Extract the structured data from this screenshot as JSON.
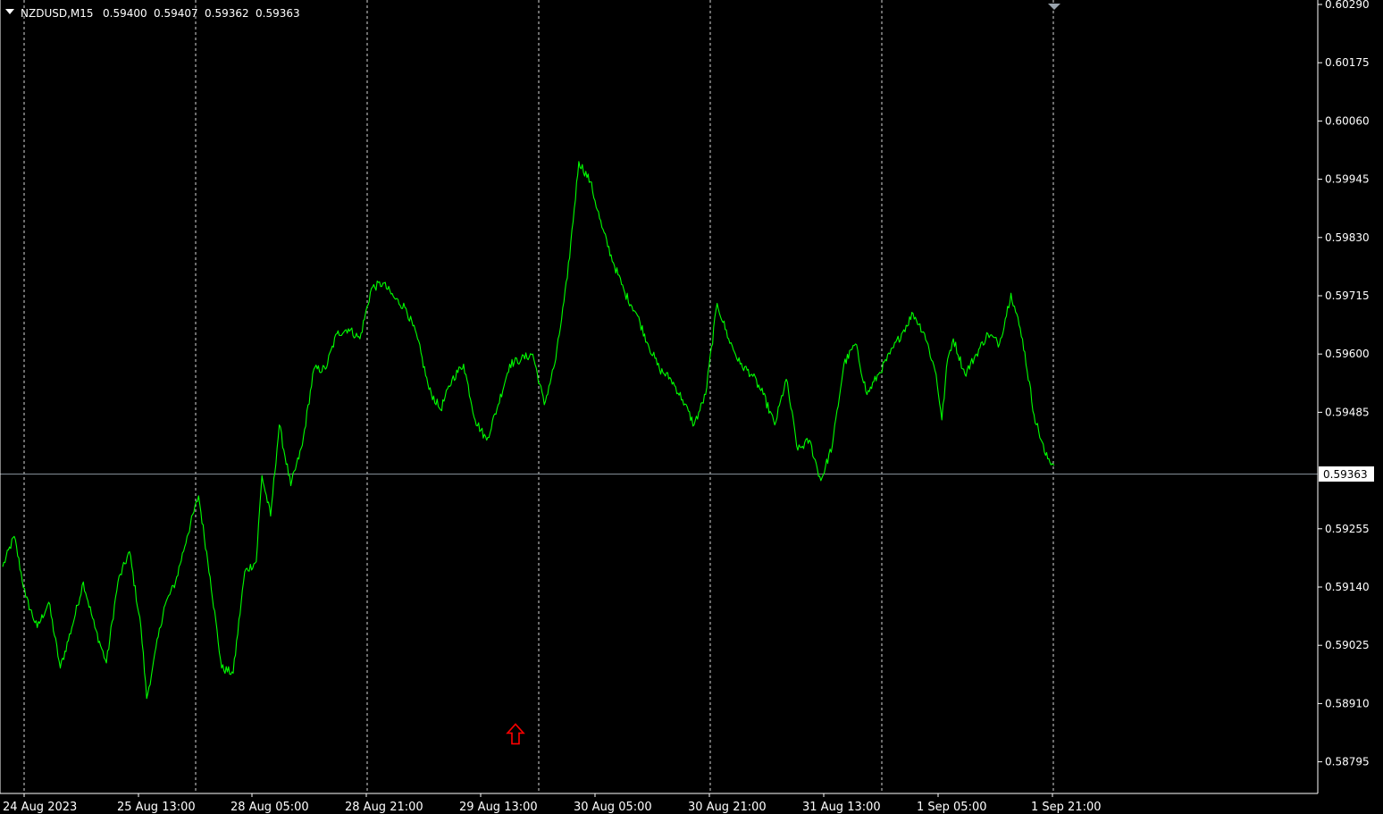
{
  "chart_header": {
    "symbol": "NZDUSD,M15",
    "open": "0.59400",
    "high": "0.59407",
    "low": "0.59362",
    "close": "0.59363"
  },
  "current_price_label": "0.59363",
  "colors": {
    "background": "#000000",
    "price_line": "#00ff00",
    "grid": "#ffffff",
    "current_price_line": "#8c96a0",
    "marker": "#ff0000",
    "axis": "#ffffff",
    "shift_marker": "#9aa4ae"
  },
  "icons": {
    "menu": "triangle-down-icon",
    "shift": "triangle-down-icon",
    "buy_arrow": "arrow-up-icon"
  },
  "chart_data": {
    "type": "line",
    "price_ticks": [
      "0.60290",
      "0.60175",
      "0.60060",
      "0.59945",
      "0.59830",
      "0.59715",
      "0.59600",
      "0.59485",
      "0.59363",
      "0.59255",
      "0.59140",
      "0.59025",
      "0.58910",
      "0.58795"
    ],
    "time_ticks": [
      "24 Aug 2023",
      "25 Aug 13:00",
      "28 Aug 05:00",
      "28 Aug 21:00",
      "29 Aug 13:00",
      "30 Aug 05:00",
      "30 Aug 21:00",
      "31 Aug 13:00",
      "1 Sep 05:00",
      "1 Sep 21:00"
    ],
    "ylim": [
      0.5874,
      0.6029
    ],
    "grid": true,
    "x_index_end": 365,
    "buy_arrow": {
      "x_index": 178,
      "price": 0.5885
    },
    "series": [
      {
        "x": [
          0,
          4,
          8,
          12,
          16,
          20,
          24,
          28,
          32,
          36,
          40,
          44,
          48,
          50,
          52,
          56,
          60,
          64,
          68,
          72,
          76,
          80,
          84,
          88,
          90,
          93,
          96,
          100,
          104,
          108,
          112,
          116,
          120,
          124,
          128,
          132,
          136,
          140,
          144,
          148,
          152,
          156,
          160,
          164,
          168,
          172,
          176,
          180,
          184,
          188,
          192,
          196,
          200,
          204,
          208,
          212,
          216,
          220,
          224,
          228,
          232,
          236,
          240,
          244,
          248,
          252,
          256,
          260,
          264,
          268,
          272,
          276,
          280,
          284,
          288,
          292,
          296,
          300,
          304,
          308,
          312,
          316,
          320,
          324,
          326,
          328,
          330,
          334,
          338,
          342,
          346,
          350,
          354,
          358,
          362,
          365
        ],
        "y": [
          0.5918,
          0.5924,
          0.5912,
          0.5906,
          0.5911,
          0.5898,
          0.5906,
          0.5915,
          0.5906,
          0.5899,
          0.5915,
          0.5921,
          0.5906,
          0.5892,
          0.5898,
          0.591,
          0.5915,
          0.5924,
          0.5932,
          0.5916,
          0.5898,
          0.5897,
          0.5917,
          0.5919,
          0.5936,
          0.5928,
          0.5946,
          0.5934,
          0.5942,
          0.5957,
          0.5957,
          0.5964,
          0.5965,
          0.5963,
          0.5973,
          0.5974,
          0.5971,
          0.5969,
          0.5963,
          0.5953,
          0.5949,
          0.5955,
          0.5958,
          0.5947,
          0.5943,
          0.595,
          0.5958,
          0.5959,
          0.596,
          0.595,
          0.5959,
          0.5975,
          0.5998,
          0.5994,
          0.5985,
          0.5978,
          0.5972,
          0.5968,
          0.5962,
          0.5957,
          0.5955,
          0.5951,
          0.5946,
          0.5952,
          0.597,
          0.5963,
          0.5958,
          0.5956,
          0.5952,
          0.5946,
          0.5955,
          0.5941,
          0.5943,
          0.5935,
          0.5942,
          0.5958,
          0.5962,
          0.5952,
          0.5956,
          0.596,
          0.5964,
          0.5968,
          0.5964,
          0.5956,
          0.5947,
          0.5959,
          0.5963,
          0.5956,
          0.596,
          0.5964,
          0.5962,
          0.5972,
          0.5963,
          0.5948,
          0.594,
          0.5938
        ]
      }
    ]
  }
}
